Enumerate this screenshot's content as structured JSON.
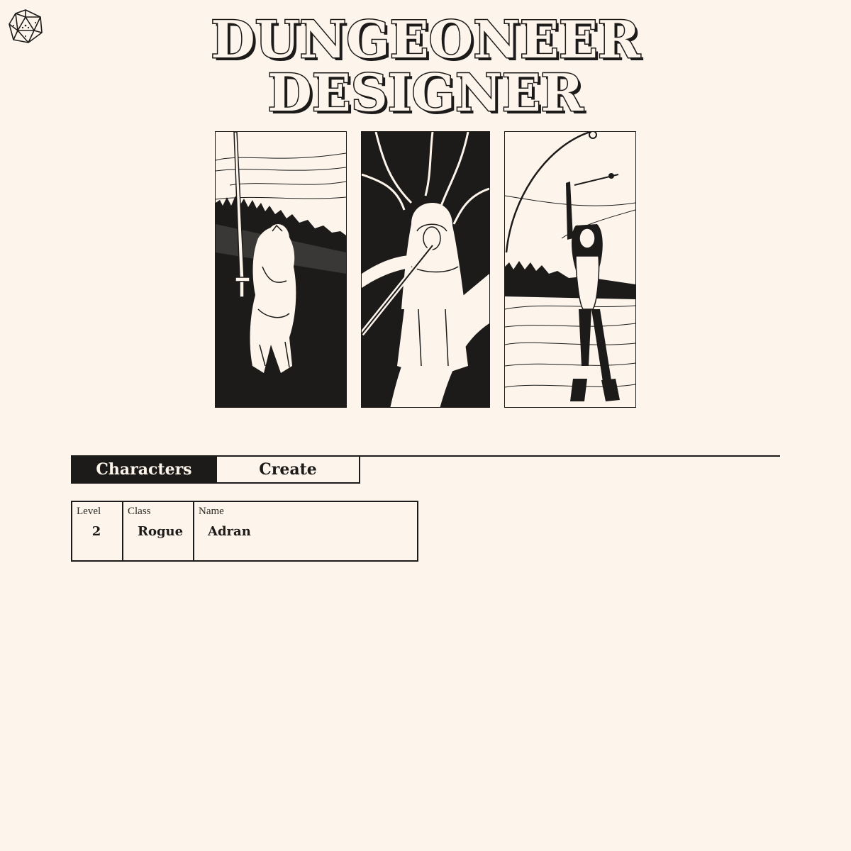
{
  "header": {
    "logo_icon": "d20-dice-icon",
    "title_line1": "DUNGEONEER",
    "title_line2": "DESIGNER"
  },
  "hero": {
    "panels": [
      "warrior-with-sword-illustration",
      "hooded-flute-player-illustration",
      "woman-with-bow-illustration"
    ]
  },
  "tabs": [
    {
      "label": "Characters",
      "active": true
    },
    {
      "label": "Create",
      "active": false
    }
  ],
  "characters": {
    "columns": {
      "level": "Level",
      "class": "Class",
      "name": "Name"
    },
    "rows": [
      {
        "level": "2",
        "class": "Rogue",
        "name": "Adran"
      }
    ]
  },
  "colors": {
    "background": "#fdf5eb",
    "ink": "#1c1b1a"
  }
}
